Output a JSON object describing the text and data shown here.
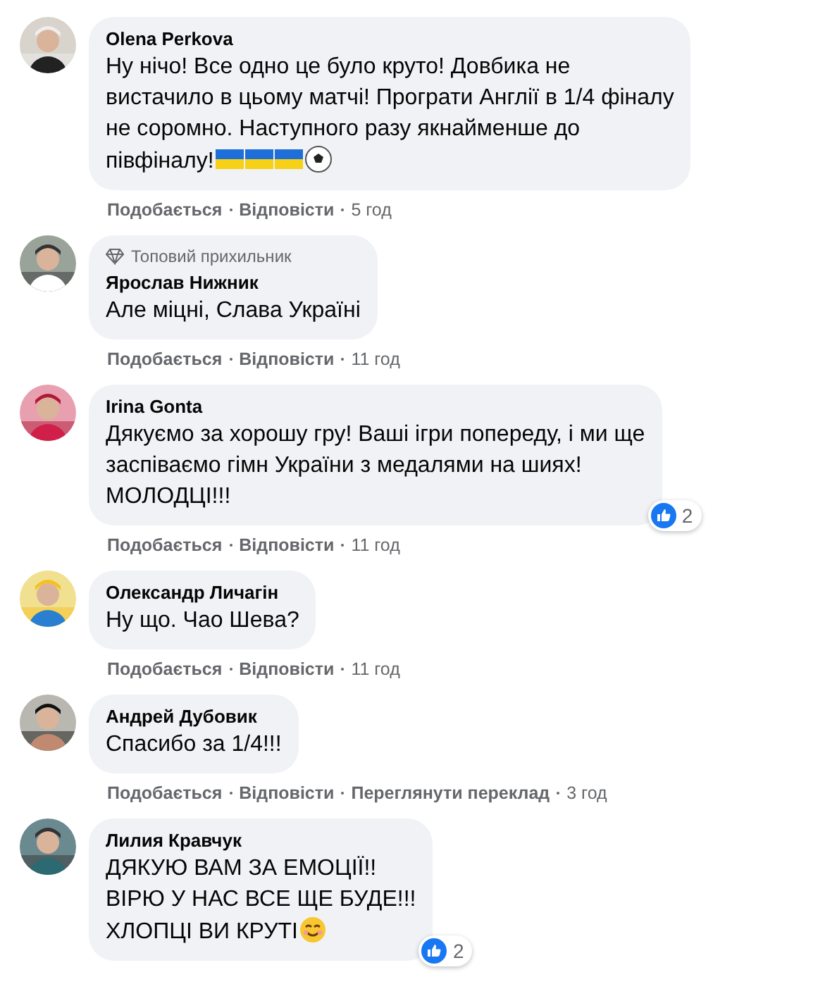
{
  "comments": [
    {
      "author": "Olena Perkova",
      "text": "Ну нічо! Все одно це було круто! Довбика не\nвистачило в цьому матчі! Програти Англії в 1/4 фіналу\nне соромно. Наступного разу якнайменше до\nпівфіналу!",
      "emoji": [
        {
          "kind": "flag"
        },
        {
          "kind": "flag"
        },
        {
          "kind": "flag"
        },
        {
          "kind": "ball"
        }
      ],
      "actions": [
        "Подобається",
        "Відповісти"
      ],
      "time": "5 год"
    },
    {
      "badge": "Топовий прихильник",
      "author": "Ярослав Нижник",
      "text": "Але міцні, Слава Україні",
      "actions": [
        "Подобається",
        "Відповісти"
      ],
      "time": "11 год"
    },
    {
      "author": "Irina Gonta",
      "text": "Дякуємо за хорошу гру! Ваші ігри попереду, і ми ще\nзаспіваємо гімн України з медалями на шиях!\nМОЛОДЦІ!!!",
      "reactions": "2",
      "actions": [
        "Подобається",
        "Відповісти"
      ],
      "time": "11 год"
    },
    {
      "author": "Олександр Личагін",
      "text": "Ну що. Чао Шева?",
      "actions": [
        "Подобається",
        "Відповісти"
      ],
      "time": "11 год"
    },
    {
      "author": "Андрей Дубовик",
      "text": "Спасибо за 1/4!!!",
      "actions": [
        "Подобається",
        "Відповісти",
        "Переглянути переклад"
      ],
      "time": "3 год"
    },
    {
      "author": "Лилия Кравчук",
      "text": "ДЯКУЮ ВАМ ЗА ЕМОЦІЇ!!\nВІРЮ У НАС ВСЕ ЩЕ БУДЕ!!!\nХЛОПЦІ ВИ КРУТІ",
      "emoji": [
        {
          "kind": "smile"
        }
      ],
      "reactions": "2"
    }
  ]
}
